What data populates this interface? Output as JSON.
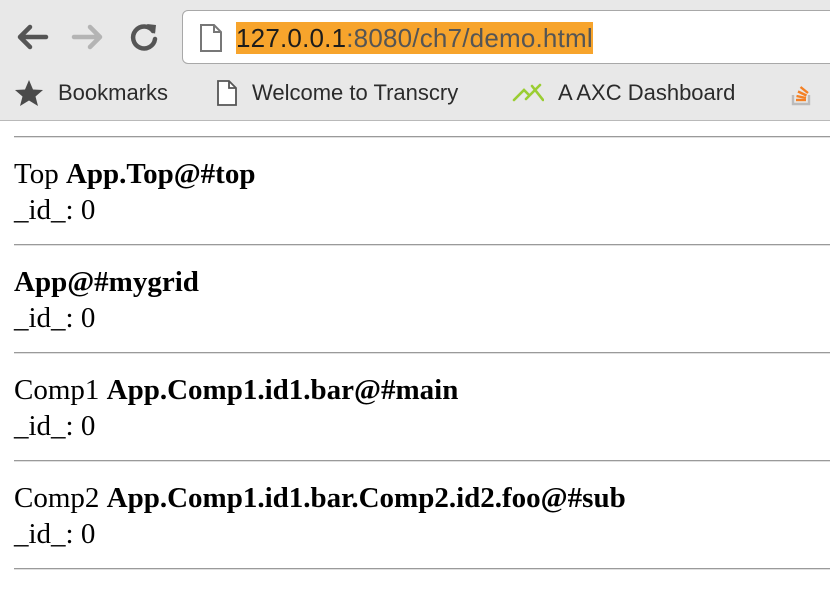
{
  "browser": {
    "url_host": "127.0.0.1",
    "url_rest": ":8080/ch7/demo.html",
    "bookmarks": [
      {
        "label": "Bookmarks",
        "icon": "star-icon"
      },
      {
        "label": "Welcome to Transcry",
        "icon": "page-icon"
      },
      {
        "label": "A AXC Dashboard",
        "icon": "axc-logo-icon"
      },
      {
        "label": "",
        "icon": "stackoverflow-icon"
      }
    ]
  },
  "components": [
    {
      "prefix": "Top",
      "path": "App.Top@#top",
      "id_label": "_id_: 0"
    },
    {
      "prefix": "",
      "path": "App@#mygrid",
      "id_label": "_id_: 0"
    },
    {
      "prefix": "Comp1",
      "path": "App.Comp1.id1.bar@#main",
      "id_label": "_id_: 0"
    },
    {
      "prefix": "Comp2",
      "path": "App.Comp1.id1.bar.Comp2.id2.foo@#sub",
      "id_label": "_id_: 0"
    }
  ],
  "colors": {
    "url_highlight": "#f7a42c",
    "axc_logo": "#9acd32",
    "stackoverflow": "#f48024"
  }
}
